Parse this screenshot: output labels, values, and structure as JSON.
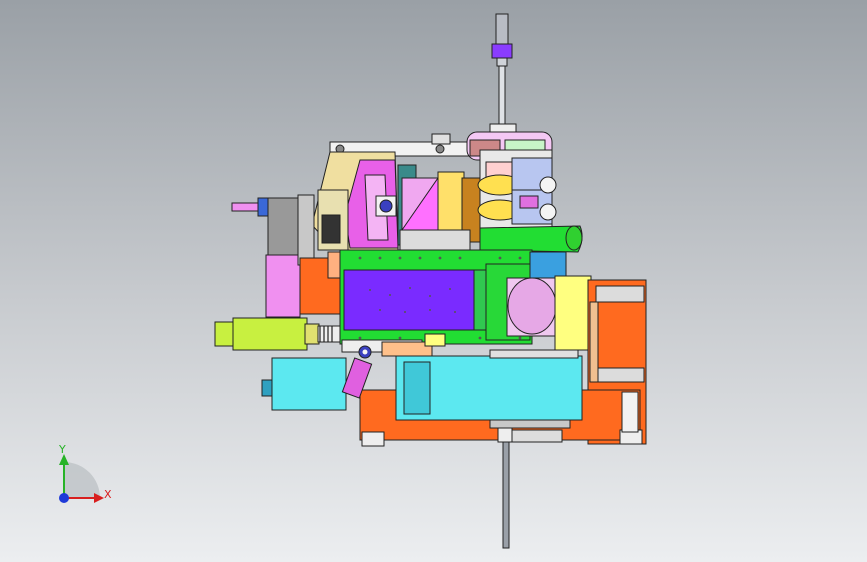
{
  "viewport": {
    "background_top": "#9aa0a6",
    "background_bottom": "#eceef0"
  },
  "model": {
    "colors": {
      "orange": "#ff6a1f",
      "violet": "#7a2bff",
      "green": "#22dd33",
      "magenta": "#e860e8",
      "pink": "#f0a0f0",
      "yellow": "#ffff80",
      "cyan": "#5ce8f0",
      "lime": "#c8f040",
      "khaki": "#f0d890",
      "teal": "#3a8a8a",
      "salmon": "#ff8a5a",
      "grey": "#9aa0a8",
      "dark": "#30343a",
      "white": "#f4f4f4"
    }
  },
  "triad": {
    "x_label": "X",
    "y_label": "Y",
    "x_color": "#d81e1e",
    "y_color": "#27b327",
    "z_color": "#1e3ad8"
  }
}
